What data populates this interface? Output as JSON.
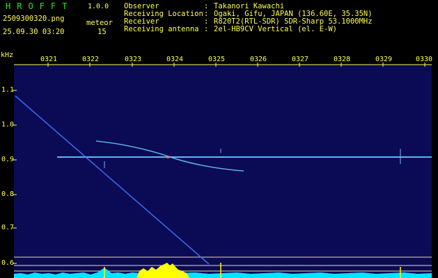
{
  "app": {
    "logo": "HROFFT",
    "version": "1.0.0",
    "filename": "2509300320.png",
    "timestamp": "25.09.30 03:20",
    "counter_label": "meteor",
    "counter_value": "15"
  },
  "meta": [
    {
      "key": "Observer",
      "value": "Takanori Kawachi"
    },
    {
      "key": "Receiving Location",
      "value": "Ogaki, Gifu, JAPAN (136.60E, 35.35N)"
    },
    {
      "key": "Receiver",
      "value": "R820T2(RTL-SDR) SDR-Sharp 53.1000MHz"
    },
    {
      "key": "Receiving antenna",
      "value": "2el-HB9CV Vertical (el. E-W)"
    }
  ],
  "axis": {
    "y_unit": "kHz",
    "x_ticks": [
      "0321",
      "0322",
      "0323",
      "0324",
      "0325",
      "0326",
      "0327",
      "0328",
      "0329",
      "0330"
    ],
    "y_ticks": [
      "1.1",
      "1.0",
      "0.9",
      "0.8",
      "0.7",
      "0.6"
    ]
  },
  "colors": {
    "background": "#000000",
    "plot_bg": "#0a0a55",
    "text": "#ffff55",
    "logo": "#33e033",
    "signal": "#66ccff",
    "spectrum": "#00e5ff",
    "peak": "#ffff00"
  }
}
